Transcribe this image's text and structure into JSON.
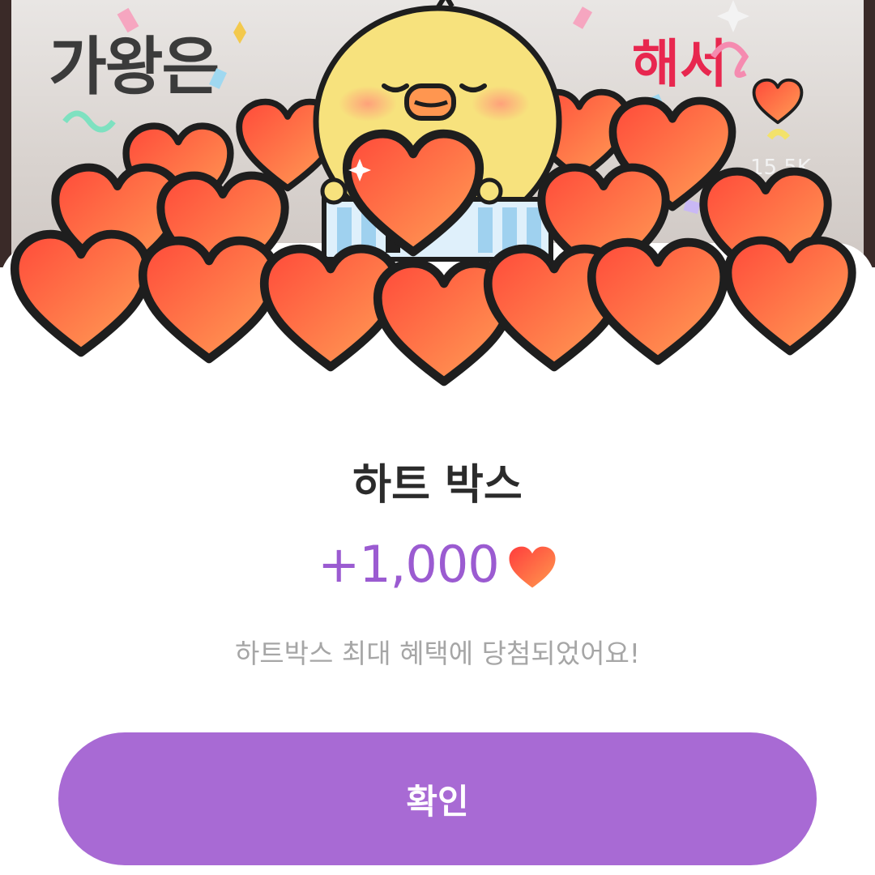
{
  "background": {
    "left_caption": "가왕은",
    "right_caption": "해서",
    "view_count": "15.5K"
  },
  "dialog": {
    "title": "하트 박스",
    "reward_amount": "+1,000",
    "reward_icon": "heart-icon",
    "message": "하트박스 최대 혜택에 당첨되었어요!",
    "confirm_label": "확인"
  },
  "colors": {
    "accent": "#a86ad4",
    "amount_text": "#9b5bd1",
    "heart": "#f0573b",
    "title_text": "#2b2b2b",
    "message_text": "#a6a6a6"
  }
}
